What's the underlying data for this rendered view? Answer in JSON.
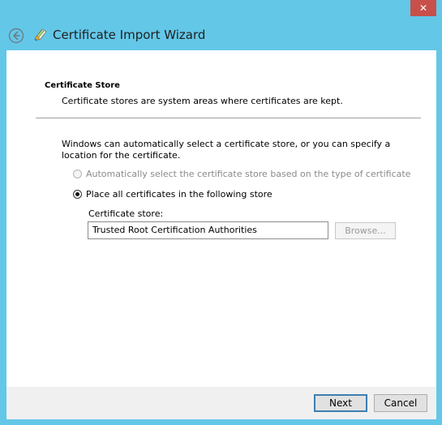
{
  "window": {
    "title": "Certificate Import Wizard",
    "close_glyph": "✕",
    "frame_color": "#63c7e8",
    "close_color": "#c7504a"
  },
  "icons": {
    "back": "back-arrow-icon",
    "app": "certificate-icon",
    "close": "close-icon"
  },
  "page": {
    "heading": "Certificate Store",
    "description": "Certificate stores are system areas where certificates are kept.",
    "explanation": "Windows can automatically select a certificate store, or you can specify a location for the certificate.",
    "option_auto": {
      "label": "Automatically select the certificate store based on the type of certificate",
      "selected": false,
      "enabled": false
    },
    "option_place": {
      "label": "Place all certificates in the following store",
      "selected": true,
      "enabled": true
    },
    "store_label": "Certificate store:",
    "store_value": "Trusted Root Certification Authorities",
    "browse_label": "Browse..."
  },
  "footer": {
    "next_label": "Next",
    "cancel_label": "Cancel"
  }
}
